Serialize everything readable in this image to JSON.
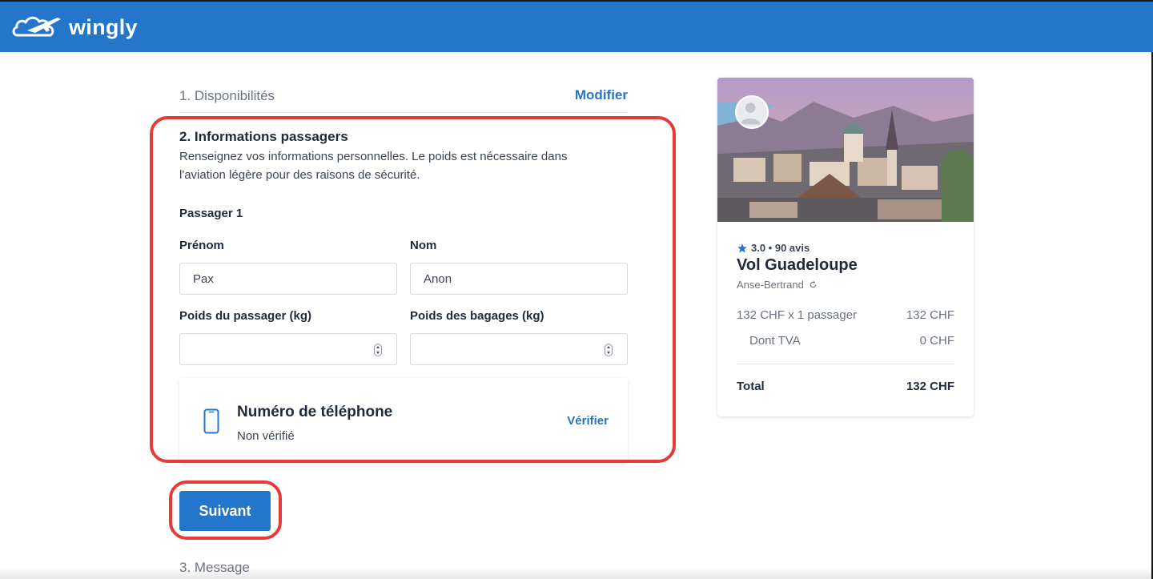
{
  "header": {
    "brand": "wingly",
    "color": "#2376c9",
    "logo_icon": "cloud-plane-icon"
  },
  "steps": {
    "step1": {
      "title": "1. Disponibilités",
      "edit_label": "Modifier"
    },
    "step2": {
      "title": "2. Informations passagers",
      "description": "Renseignez vos informations personnelles. Le poids est nécessaire dans l'aviation légère pour des raisons de sécurité.",
      "passenger_title": "Passager 1",
      "fields": {
        "first_name": {
          "label": "Prénom",
          "value": "Pax"
        },
        "last_name": {
          "label": "Nom",
          "value": "Anon"
        },
        "passenger_weight": {
          "label": "Poids du passager (kg)",
          "value": ""
        },
        "baggage_weight": {
          "label": "Poids des bagages (kg)",
          "value": ""
        }
      },
      "phone": {
        "icon": "smartphone-icon",
        "title": "Numéro de téléphone",
        "status": "Non vérifié",
        "verify_label": "Vérifier"
      }
    },
    "next_label": "Suivant",
    "step3": {
      "title": "3. Message"
    }
  },
  "summary": {
    "rating_icon": "star-icon",
    "rating": "3.0 • 90 avis",
    "title": "Vol Guadeloupe",
    "location": "Anse-Bertrand",
    "location_icon": "refresh-icon",
    "line_label": "132 CHF x 1 passager",
    "line_value": "132 CHF",
    "vat_label": "Dont TVA",
    "vat_value": "0 CHF",
    "total_label": "Total",
    "total_value": "132 CHF"
  },
  "colors": {
    "accent": "#2376c9",
    "annotation": "#e53a3a"
  }
}
